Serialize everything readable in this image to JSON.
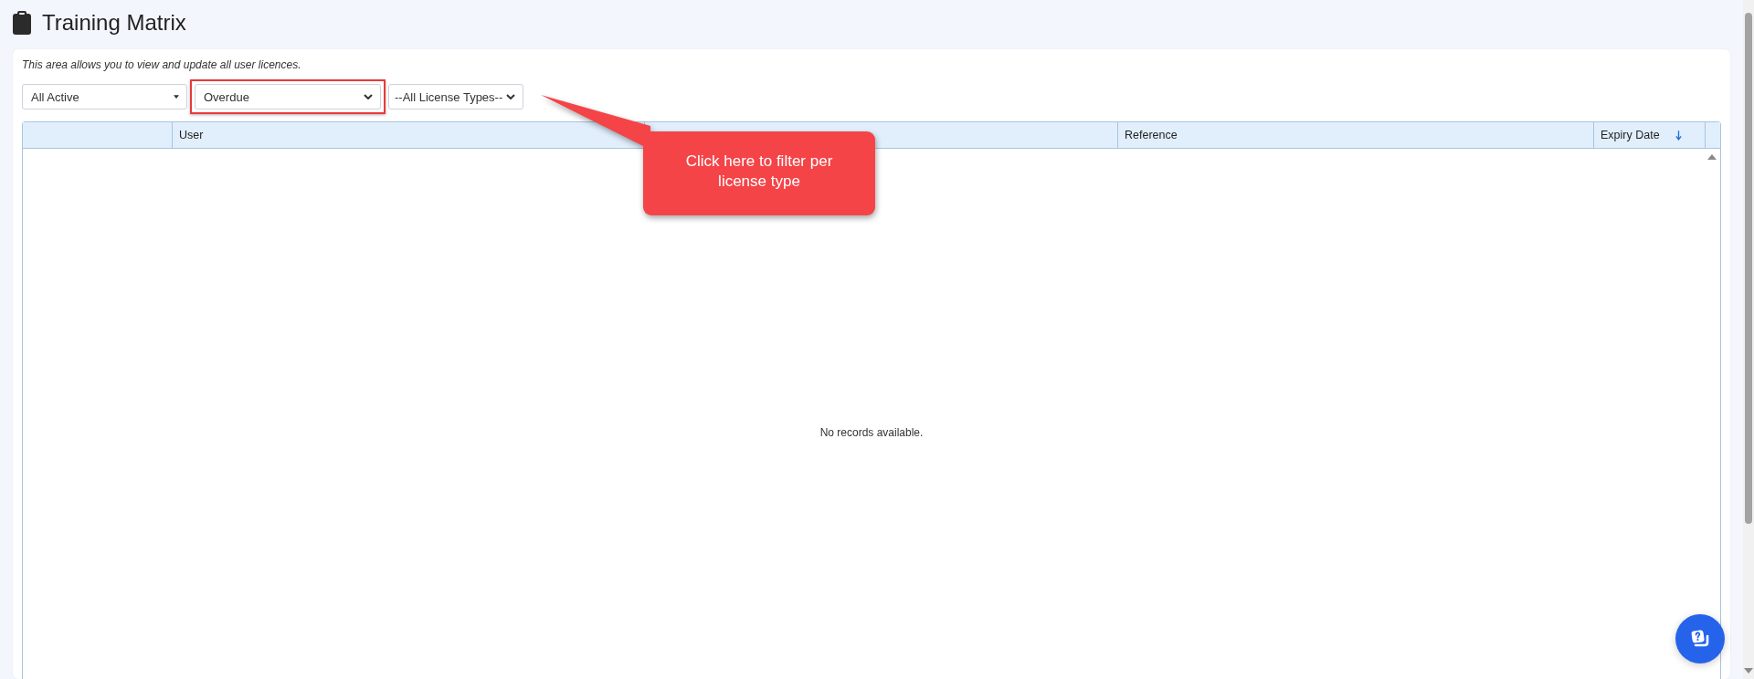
{
  "page": {
    "title": "Training Matrix"
  },
  "description": "This area allows you to view and update all user licences.",
  "filters": [
    {
      "value": "All Active",
      "kind": "caret",
      "highlighted": false
    },
    {
      "value": "Overdue",
      "kind": "chevron",
      "highlighted": true
    },
    {
      "value": "--All License Types--",
      "kind": "chevron",
      "highlighted": false
    }
  ],
  "table": {
    "columns": [
      {
        "sorted": false
      },
      {
        "label": "User",
        "sorted": false
      },
      {
        "sorted": false
      },
      {
        "label": "Reference",
        "sorted": false
      },
      {
        "label": "Expiry Date",
        "sorted": true
      }
    ],
    "empty_message": "No records available."
  },
  "callout": {
    "text": "Click here to filter per license type"
  }
}
